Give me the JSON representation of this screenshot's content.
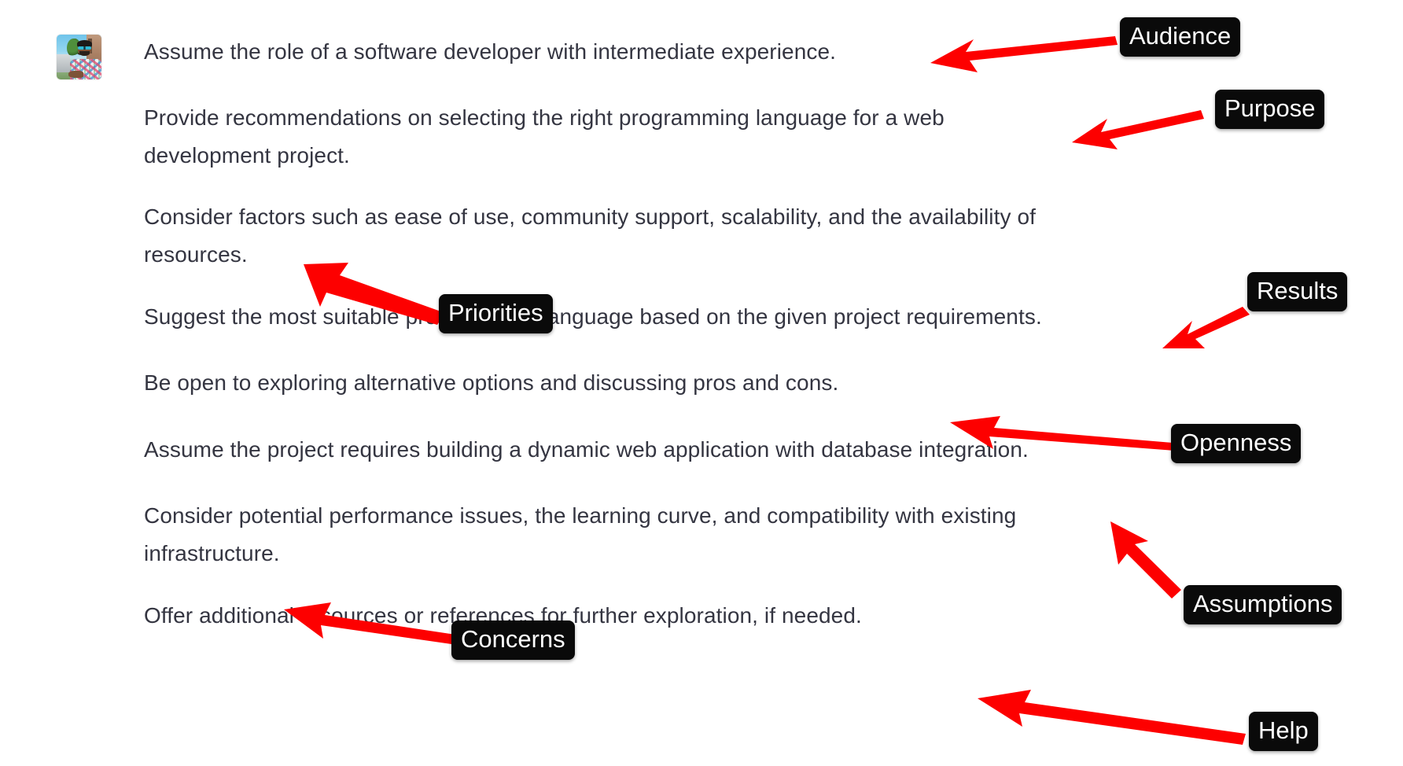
{
  "page": {
    "background_color": "#ffffff",
    "text_color": "#343541",
    "annotation_color": "#ff0000",
    "badge_background": "#0a0a0a",
    "badge_text_color": "#ffffff"
  },
  "avatar": {
    "alt": "user profile photo"
  },
  "message": {
    "paragraphs": [
      "Assume the role of a software developer with intermediate experience.",
      "Provide recommendations on selecting the right programming language for a web\ndevelopment project.",
      "Consider factors such as ease of use, community support, scalability, and the availability of\nresources.",
      "Suggest the most suitable programming language based on the given project requirements.",
      "Be open to exploring alternative options and discussing pros and cons.",
      "Assume the project requires building a dynamic web application with database integration.",
      "Consider potential performance issues, the learning curve, and compatibility with existing\ninfrastructure.",
      "Offer additional resources or references for further exploration, if needed."
    ]
  },
  "annotations": [
    {
      "label": "Audience",
      "targets_paragraph": 0
    },
    {
      "label": "Purpose",
      "targets_paragraph": 1
    },
    {
      "label": "Priorities",
      "targets_paragraph": 2
    },
    {
      "label": "Results",
      "targets_paragraph": 3
    },
    {
      "label": "Openness",
      "targets_paragraph": 4
    },
    {
      "label": "Assumptions",
      "targets_paragraph": 5
    },
    {
      "label": "Concerns",
      "targets_paragraph": 6
    },
    {
      "label": "Help",
      "targets_paragraph": 7
    }
  ]
}
